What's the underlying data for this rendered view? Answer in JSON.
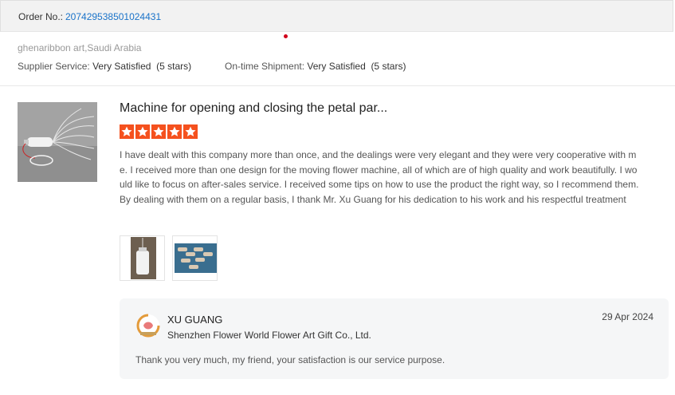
{
  "order": {
    "label": "Order No.:",
    "number": "207429538501024431"
  },
  "buyer": {
    "name_location": "ghenaribbon art,Saudi Arabia"
  },
  "ratings": {
    "supplier_label": "Supplier Service:",
    "supplier_value": "Very Satisfied",
    "supplier_stars": "(5 stars)",
    "shipment_label": "On-time Shipment:",
    "shipment_value": "Very Satisfied",
    "shipment_stars": "(5 stars)"
  },
  "review": {
    "product_title": "Machine for opening and closing the petal par...",
    "star_count": 5,
    "star_color": "#f5511e",
    "text": "I have dealt with this company more than once, and the dealings were very elegant and they were very cooperative with me.  I received more than one design for the moving flower machine, all of which are of high quality and work beautifully.  I would like to focus on after-sales service.  I received some tips on how to use the product the right way, so I recommend them.  By dealing with them on a regular basis, I thank Mr. Xu Guang for his dedication to his work and his respectful treatment",
    "photo_count": 2
  },
  "reply": {
    "name": "XU GUANG",
    "company": "Shenzhen Flower World Flower Art Gift Co., Ltd.",
    "date": "29 Apr 2024",
    "text": "Thank you very much, my friend, your satisfaction is our service purpose."
  },
  "colors": {
    "link": "#1a73c9",
    "accent_star": "#f5511e",
    "alert_dot": "#d0021b"
  }
}
